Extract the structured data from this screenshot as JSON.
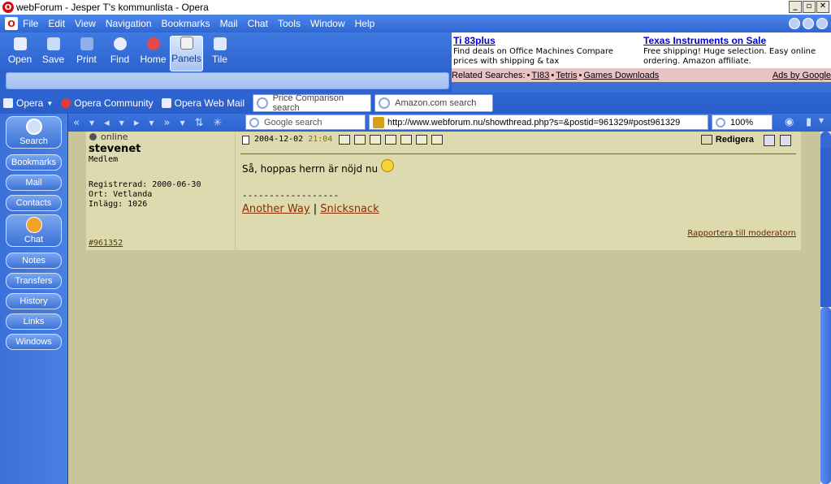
{
  "window": {
    "title": "webForum - Jesper T's kommunlista - Opera",
    "controls": [
      "_",
      "▫",
      "✕"
    ]
  },
  "menu": [
    "File",
    "Edit",
    "View",
    "Navigation",
    "Bookmarks",
    "Mail",
    "Chat",
    "Tools",
    "Window",
    "Help"
  ],
  "toolbar": [
    {
      "label": "Open",
      "icon": "folder-icon"
    },
    {
      "label": "Save",
      "icon": "save-icon"
    },
    {
      "label": "Print",
      "icon": "print-icon"
    },
    {
      "label": "Find",
      "icon": "find-icon"
    },
    {
      "label": "Home",
      "icon": "home-icon"
    },
    {
      "label": "Panels",
      "icon": "panels-icon",
      "active": true
    },
    {
      "label": "Tile",
      "icon": "tile-icon"
    }
  ],
  "ad": {
    "ad1": {
      "title": "Ti 83plus",
      "desc": "Find deals on Office Machines Compare prices with shipping & tax"
    },
    "ad2": {
      "title": "Texas Instruments on Sale",
      "desc": "Free shipping! Huge selection. Easy online ordering. Amazon affiliate."
    },
    "related_label": "Related Searches:",
    "related": [
      "TI83",
      "Tetris",
      "Games Downloads"
    ],
    "ads_by": "Ads by Google"
  },
  "personal_bar": {
    "items": [
      {
        "label": "Opera",
        "icon": "folder-icon"
      },
      {
        "label": "Opera Community",
        "icon": "opera-icon"
      },
      {
        "label": "Opera Web Mail",
        "icon": "page-icon"
      }
    ],
    "search_fields": [
      "Price Comparison search",
      "Amazon.com search"
    ]
  },
  "navbar": {
    "google_search": "Google search",
    "url": "http://www.webforum.nu/showthread.php?s=&postid=961329#post961329",
    "zoom": "100%"
  },
  "panel": {
    "buttons": [
      "Search",
      "Bookmarks",
      "Mail",
      "Contacts",
      "Chat",
      "Notes",
      "Transfers",
      "History",
      "Links",
      "Windows"
    ]
  },
  "post": {
    "status": "online",
    "username": "stevenet",
    "user_title": "Medlem",
    "registered": "Registrerad: 2000-06-30",
    "location": "Ort: Vetlanda",
    "posts": "Inlägg: 1026",
    "post_link": "#961352",
    "date": "2004-12-02",
    "time": "21:04",
    "edit_label": "Redigera",
    "message": "Så, hoppas herrn är nöjd nu",
    "separator": "------------------",
    "sig_link1": "Another Way",
    "sig_sep": "|",
    "sig_link2": "Snicksnack",
    "report": "Rapportera till moderatorn"
  },
  "colors": {
    "chrome_blue": "#2d63cf",
    "content_bg": "#c8c59a",
    "post_bg": "#dddaaf",
    "link_color": "#8a2b00"
  }
}
